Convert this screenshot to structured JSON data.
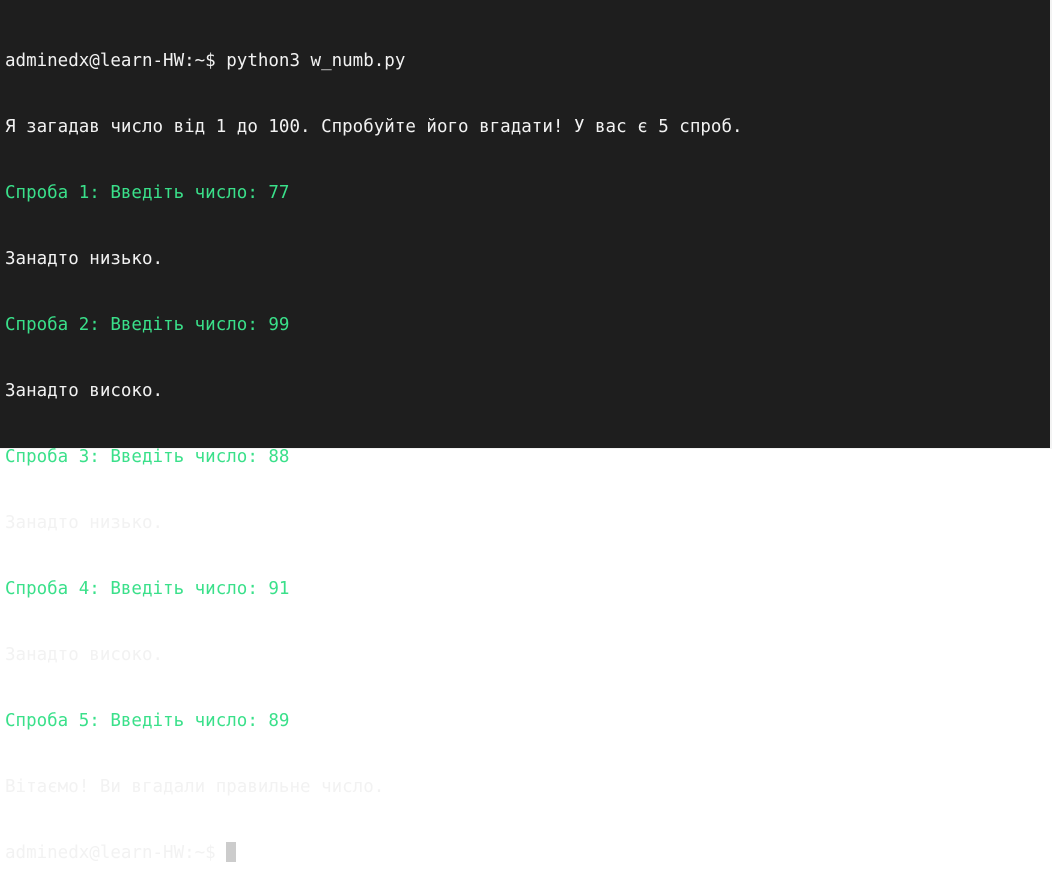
{
  "terminal": {
    "lines": [
      {
        "text": "adminedx@learn-HW:~$ python3 w_numb.py",
        "color": "#f2f2f2"
      },
      {
        "text": "Я загадав число від 1 до 100. Спробуйте його вгадати! У вас є 5 спроб.",
        "color": "#f2f2f2"
      },
      {
        "text": "Спроба 1: Введіть число: 77",
        "color": "#3ae08a"
      },
      {
        "text": "Занадто низько.",
        "color": "#f2f2f2"
      },
      {
        "text": "Спроба 2: Введіть число: 99",
        "color": "#3ae08a"
      },
      {
        "text": "Занадто високо.",
        "color": "#f2f2f2"
      },
      {
        "text": "Спроба 3: Введіть число: 88",
        "color": "#3ae08a"
      },
      {
        "text": "Занадто низько.",
        "color": "#f2f2f2"
      },
      {
        "text": "Спроба 4: Введіть число: 91",
        "color": "#3ae08a"
      },
      {
        "text": "Занадто високо.",
        "color": "#f2f2f2"
      },
      {
        "text": "Спроба 5: Введіть число: 89",
        "color": "#3ae08a"
      },
      {
        "text": "Вітаємо! Ви вгадали правильне число.",
        "color": "#f2f2f2"
      }
    ],
    "prompt": "adminedx@learn-HW:~$ ",
    "background": "#1e1e1e",
    "accent_color": "#3ae08a"
  }
}
